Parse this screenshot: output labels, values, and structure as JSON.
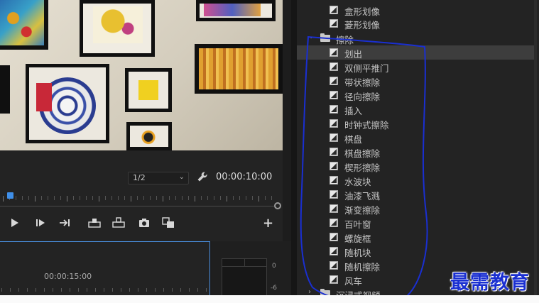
{
  "program_monitor": {
    "resolution": "1/2",
    "resolution_chevron": "⌄",
    "timecode": "00:00:10:00",
    "add_symbol": "+"
  },
  "timeline": {
    "timecode_ruler": "00:00:15:00"
  },
  "audio_meter": {
    "db_top": "0",
    "db_mid": "-6"
  },
  "effects": {
    "items_top": [
      {
        "label": "盒形划像"
      },
      {
        "label": "菱形划像"
      }
    ],
    "folder": {
      "label": "擦除",
      "chevron": "⌄"
    },
    "items": [
      {
        "label": "划出",
        "selected": true
      },
      {
        "label": "双侧平推门"
      },
      {
        "label": "带状擦除"
      },
      {
        "label": "径向擦除"
      },
      {
        "label": "插入"
      },
      {
        "label": "时钟式擦除"
      },
      {
        "label": "棋盘"
      },
      {
        "label": "棋盘擦除"
      },
      {
        "label": "楔形擦除"
      },
      {
        "label": "水波块"
      },
      {
        "label": "油漆飞溅"
      },
      {
        "label": "渐变擦除"
      },
      {
        "label": "百叶窗"
      },
      {
        "label": "螺旋框"
      },
      {
        "label": "随机块"
      },
      {
        "label": "随机擦除"
      },
      {
        "label": "风车"
      }
    ],
    "next_folder": {
      "label": "沉浸式视频",
      "chevron": "›"
    }
  },
  "watermark": "最需教育",
  "colors": {
    "accent_blue": "#3f8fe9",
    "annotation": "#1a2fd1",
    "panel_bg": "#232323"
  }
}
